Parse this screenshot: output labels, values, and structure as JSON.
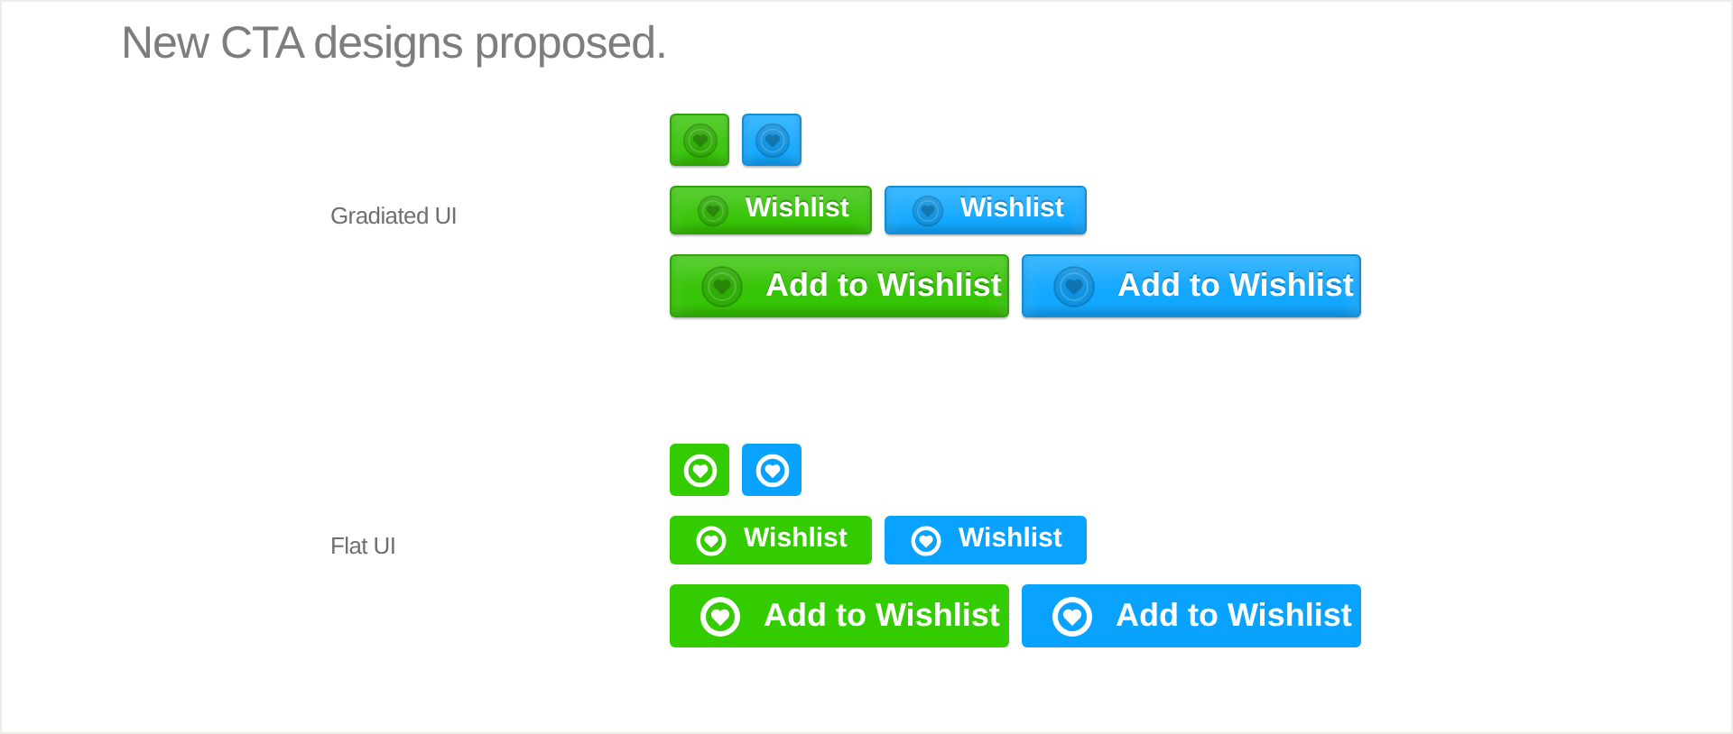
{
  "heading": "New CTA designs proposed.",
  "sections": [
    {
      "label": "Gradiated UI",
      "kind": "gradient",
      "rows": [
        [
          {
            "kind": "icon",
            "color": "#36c406"
          },
          {
            "kind": "icon",
            "color": "#12a8ff"
          }
        ],
        [
          {
            "kind": "small",
            "text": "Wishlist",
            "color": "#36c406"
          },
          {
            "kind": "small",
            "text": "Wishlist",
            "color": "#12a8ff"
          }
        ],
        [
          {
            "kind": "large",
            "text": "Add to Wishlist",
            "color": "#36c406"
          },
          {
            "kind": "large",
            "text": "Add to Wishlist",
            "color": "#12a8ff"
          }
        ]
      ]
    },
    {
      "label": "Flat UI",
      "kind": "flat",
      "rows": [
        [
          {
            "kind": "icon",
            "color": "#33cc00"
          },
          {
            "kind": "icon",
            "color": "#0aa2ff"
          }
        ],
        [
          {
            "kind": "small",
            "text": "Wishlist",
            "color": "#33cc00"
          },
          {
            "kind": "small",
            "text": "Wishlist",
            "color": "#0aa2ff"
          }
        ],
        [
          {
            "kind": "large",
            "text": "Add to Wishlist",
            "color": "#33cc00"
          },
          {
            "kind": "large",
            "text": "Add to Wishlist",
            "color": "#0aa2ff"
          }
        ]
      ]
    }
  ]
}
